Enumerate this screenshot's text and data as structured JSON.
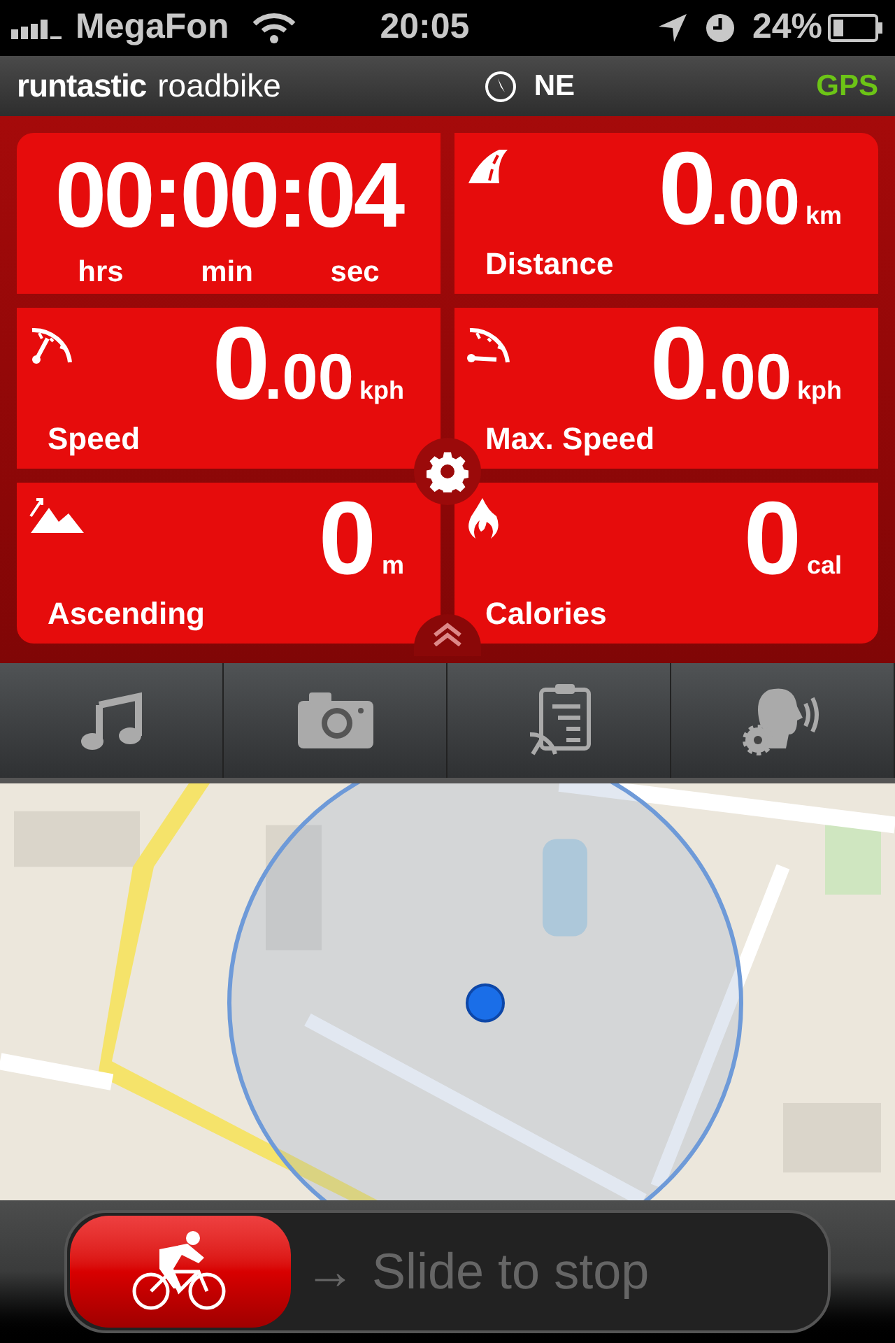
{
  "status_bar": {
    "carrier": "MegaFon",
    "time": "20:05",
    "battery": "24%"
  },
  "header": {
    "brand": "runtastic",
    "product": "roadbike",
    "heading": "NE",
    "gps": "GPS"
  },
  "tiles": [
    {
      "kind": "timer",
      "value": "00:00:04",
      "units": [
        "hrs",
        "min",
        "sec"
      ]
    },
    {
      "kind": "metric",
      "value": "0",
      "decimals": ".00",
      "unit": "km",
      "label": "Distance"
    },
    {
      "kind": "metric",
      "value": "0",
      "decimals": ".00",
      "unit": "kph",
      "label": "Speed"
    },
    {
      "kind": "metric",
      "value": "0",
      "decimals": ".00",
      "unit": "kph",
      "label": "Max. Speed"
    },
    {
      "kind": "metric",
      "value": "0",
      "unit": "m",
      "label": "Ascending"
    },
    {
      "kind": "metric",
      "value": "0",
      "unit": "cal",
      "label": "Calories"
    }
  ],
  "slider": {
    "arrow": "→",
    "label": "Slide to stop",
    "level": 0
  }
}
